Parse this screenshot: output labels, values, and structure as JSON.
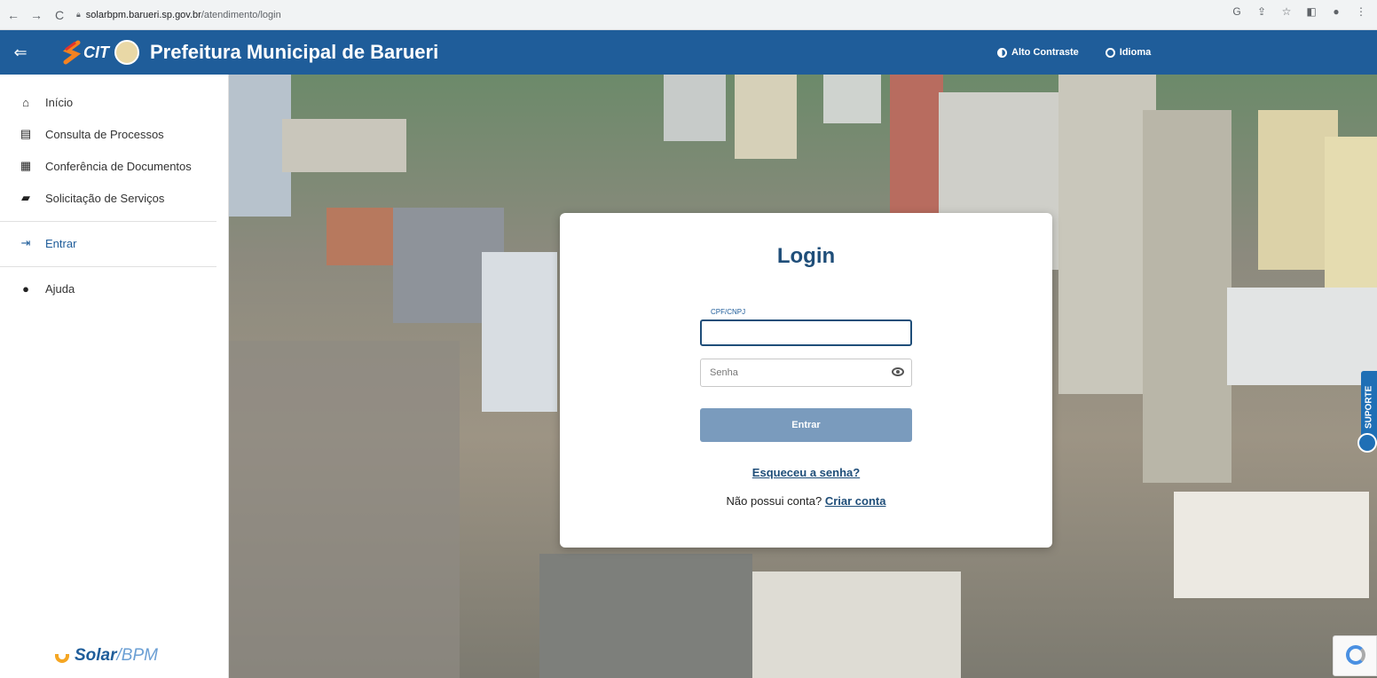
{
  "browser": {
    "back_icon": "arrow-left",
    "forward_icon": "arrow-right",
    "reload_icon": "reload",
    "url_host": "solarbpm.barueri.sp.gov.br",
    "url_path": "/atendimento/login"
  },
  "header": {
    "logo_text": "CIT",
    "title": "Prefeitura Municipal de Barueri",
    "actions": [
      {
        "label": "Alto Contraste",
        "icon": "contrast-icon"
      },
      {
        "label": "Idioma",
        "icon": "globe-icon"
      }
    ],
    "bg_color": "#1f5d9a"
  },
  "sidebar": {
    "items": [
      {
        "label": "Início",
        "icon": "home-icon"
      },
      {
        "label": "Consulta de Processos",
        "icon": "list-icon"
      },
      {
        "label": "Conferência de Documentos",
        "icon": "clipboard-icon"
      },
      {
        "label": "Solicitação de Serviços",
        "icon": "folder-plus-icon"
      }
    ],
    "enter": {
      "label": "Entrar",
      "icon": "login-icon"
    },
    "help": {
      "label": "Ajuda",
      "icon": "help-icon"
    },
    "footer_logo": {
      "solar": "Solar",
      "bpm": "/BPM"
    }
  },
  "login": {
    "title": "Login",
    "cpf_label": "CPF/CNPJ",
    "cpf_value": "",
    "password_placeholder": "Senha",
    "submit_label": "Entrar",
    "forgot_link": "Esqueceu a senha?",
    "signup_prompt": "Não possui conta?",
    "signup_link": "Criar conta"
  },
  "support": {
    "label": "SUPORTE"
  }
}
